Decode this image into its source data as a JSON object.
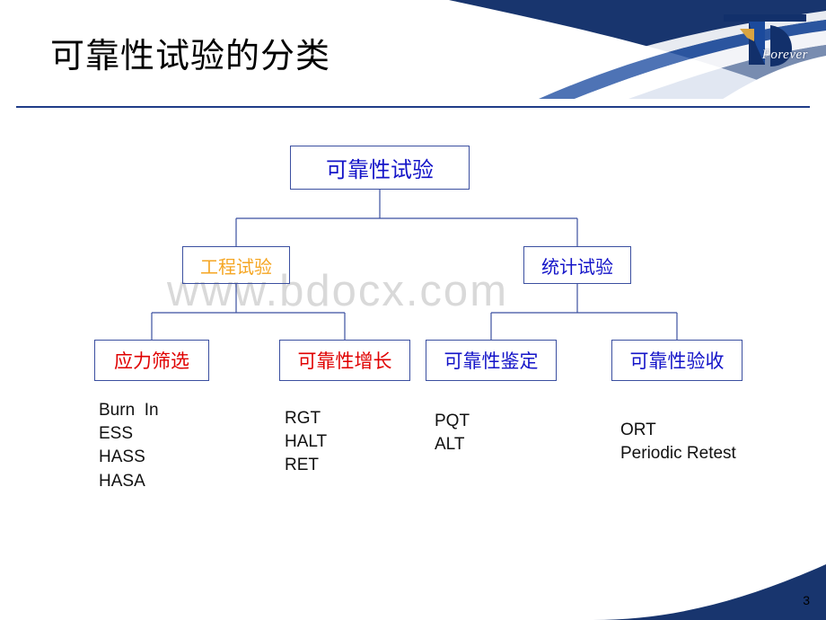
{
  "slide": {
    "title": "可靠性试验的分类",
    "page_number": "3",
    "watermark": "www.bdocx.com",
    "logo_text": "Forever",
    "accent_color": "#1f3c88"
  },
  "diagram": {
    "type": "tree",
    "nodes": {
      "root": {
        "label": "可靠性试验",
        "color": "#1414c8"
      },
      "engineering": {
        "label": "工程试验",
        "color": "#f5a623"
      },
      "statistical": {
        "label": "统计试验",
        "color": "#1414c8"
      },
      "leaf1": {
        "label": "应力筛选",
        "color": "#e00000"
      },
      "leaf2": {
        "label": "可靠性增长",
        "color": "#e00000"
      },
      "leaf3": {
        "label": "可靠性鉴定",
        "color": "#1414c8"
      },
      "leaf4": {
        "label": "可靠性验收",
        "color": "#1414c8"
      }
    },
    "leaf_lists": {
      "leaf1_items": "Burn  In\nESS\nHASS\nHASA",
      "leaf2_items": "RGT\nHALT\nRET",
      "leaf3_items": "PQT\nALT",
      "leaf4_items": "ORT\nPeriodic Retest"
    }
  }
}
